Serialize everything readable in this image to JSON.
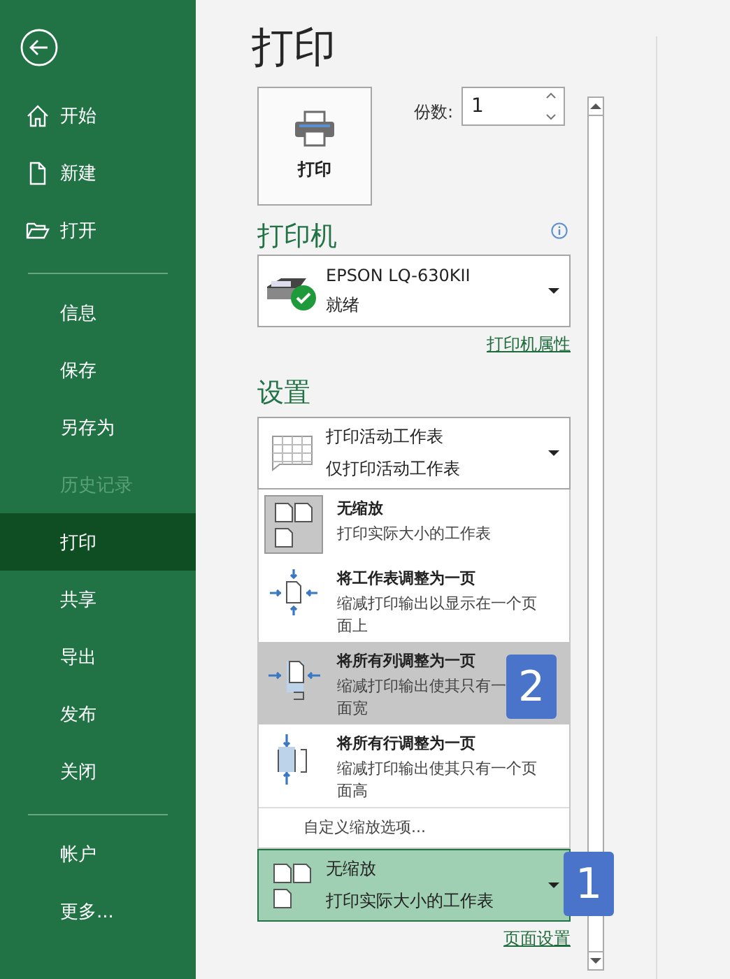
{
  "sidebar": {
    "groups": [
      [
        {
          "label": "开始",
          "selected": false,
          "disabled": false
        },
        {
          "label": "新建",
          "selected": false,
          "disabled": false
        },
        {
          "label": "打开",
          "selected": false,
          "disabled": false
        }
      ],
      [
        {
          "label": "信息",
          "selected": false,
          "disabled": false
        },
        {
          "label": "保存",
          "selected": false,
          "disabled": false
        },
        {
          "label": "另存为",
          "selected": false,
          "disabled": false
        },
        {
          "label": "历史记录",
          "selected": false,
          "disabled": true
        },
        {
          "label": "打印",
          "selected": true,
          "disabled": false
        },
        {
          "label": "共享",
          "selected": false,
          "disabled": false
        },
        {
          "label": "导出",
          "selected": false,
          "disabled": false
        },
        {
          "label": "发布",
          "selected": false,
          "disabled": false
        },
        {
          "label": "关闭",
          "selected": false,
          "disabled": false
        }
      ],
      [
        {
          "label": "帐户",
          "selected": false,
          "disabled": false
        },
        {
          "label": "更多...",
          "selected": false,
          "disabled": false
        }
      ]
    ]
  },
  "title": "打印",
  "print_button": "打印",
  "copies": {
    "label": "份数:",
    "value": "1"
  },
  "printer": {
    "heading": "打印机",
    "name": "EPSON LQ-630KII",
    "status": "就绪",
    "properties_link": "打印机属性"
  },
  "settings": {
    "heading": "设置",
    "scope": {
      "title": "打印活动工作表",
      "subtitle": "仅打印活动工作表"
    },
    "menu": [
      {
        "kind": "no-scale",
        "title": "无缩放",
        "description": [
          "打印实际大小的工作表"
        ],
        "selected": true,
        "hovered": false
      },
      {
        "kind": "fit-sheet",
        "title": "将工作表调整为一页",
        "description": [
          "缩减打印输出以显示在一个页",
          "面上"
        ],
        "selected": false,
        "hovered": false
      },
      {
        "kind": "fit-columns",
        "title": "将所有列调整为一页",
        "description": [
          "缩减打印输出使其只有一",
          "面宽"
        ],
        "selected": false,
        "hovered": true
      },
      {
        "kind": "fit-rows",
        "title": "将所有行调整为一页",
        "description": [
          "缩减打印输出使其只有一个页",
          "面高"
        ],
        "selected": false,
        "hovered": false
      },
      {
        "kind": "link",
        "title": "自定义缩放选项...",
        "selected": false,
        "hovered": false
      }
    ],
    "scaling": {
      "title": "无缩放",
      "subtitle": "打印实际大小的工作表"
    },
    "page_setup_link": "页面设置"
  },
  "callouts": [
    {
      "number": "2"
    },
    {
      "number": "1"
    }
  ]
}
